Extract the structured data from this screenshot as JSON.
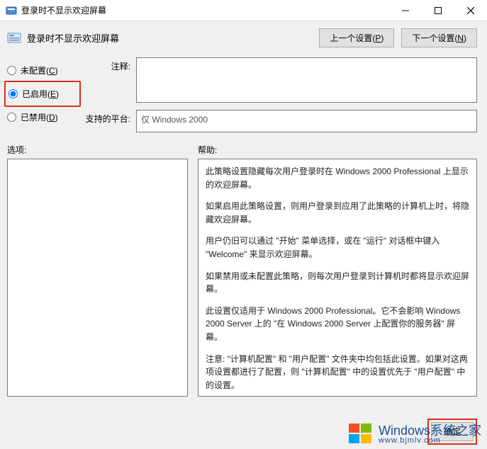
{
  "window": {
    "title": "登录时不显示欢迎屏幕"
  },
  "header": {
    "title": "登录时不显示欢迎屏幕",
    "prev_setting": "上一个设置(P)",
    "next_setting": "下一个设置(N)"
  },
  "radios": {
    "not_configured": "未配置(C)",
    "enabled": "已启用(E)",
    "disabled": "已禁用(D)",
    "selected": "enabled"
  },
  "fields": {
    "comment_label": "注释:",
    "comment_value": "",
    "platform_label": "支持的平台:",
    "platform_value": "仅 Windows 2000"
  },
  "lower": {
    "options_label": "选项:",
    "help_label": "帮助:",
    "help_paragraphs": [
      "此策略设置隐藏每次用户登录时在 Windows 2000 Professional 上显示的欢迎屏幕。",
      "如果启用此策略设置，则用户登录到应用了此策略的计算机上时，将隐藏欢迎屏幕。",
      "用户仍旧可以通过 \"开始\" 菜单选择，或在 \"运行\" 对话框中键入 \"Welcome\" 来显示欢迎屏幕。",
      "如果禁用或未配置此策略，则每次用户登录到计算机时都将显示欢迎屏幕。",
      "此设置仅适用于 Windows 2000 Professional。它不会影响 Windows 2000 Server 上的 \"在 Windows 2000 Server 上配置你的服务器\" 屏幕。",
      "注意: \"计算机配置\" 和 \"用户配置\" 文件夹中均包括此设置。如果对这两项设置都进行了配置，则 \"计算机配置\" 中的设置优先于 \"用户配置\" 中的设置。"
    ]
  },
  "footer": {
    "ok": "确定"
  },
  "watermark": {
    "main": "Windows系统之家",
    "sub": "www.bjmlv.com"
  }
}
